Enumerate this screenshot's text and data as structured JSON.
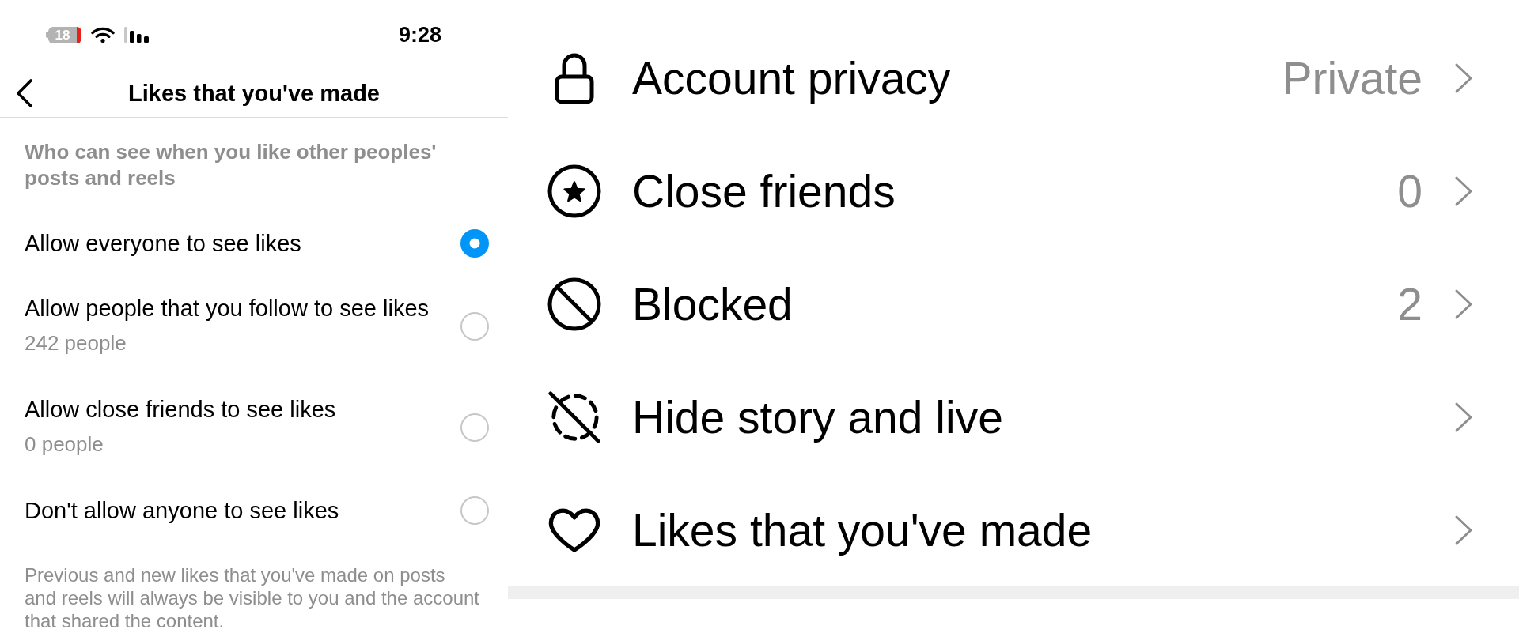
{
  "status_bar": {
    "battery": "18",
    "time": "9:28"
  },
  "header": {
    "title": "Likes that you've made"
  },
  "likes_settings": {
    "description": "Who can see when you like other peoples' posts and reels",
    "options": [
      {
        "label": "Allow everyone to see likes",
        "selected": true
      },
      {
        "label": "Allow people that you follow to see likes",
        "count": "242 people",
        "selected": false
      },
      {
        "label": "Allow close friends to see likes",
        "count": "0 people",
        "selected": false
      },
      {
        "label": "Don't allow anyone to see likes",
        "selected": false
      }
    ],
    "footnote": "Previous and new likes that you've made on posts and reels will always be visible to you and the account that shared the content."
  },
  "privacy_settings": {
    "items": [
      {
        "label": "Account privacy",
        "value": "Private"
      },
      {
        "label": "Close friends",
        "value": "0"
      },
      {
        "label": "Blocked",
        "value": "2"
      },
      {
        "label": "Hide story and live"
      },
      {
        "label": "Likes that you've made"
      }
    ]
  }
}
